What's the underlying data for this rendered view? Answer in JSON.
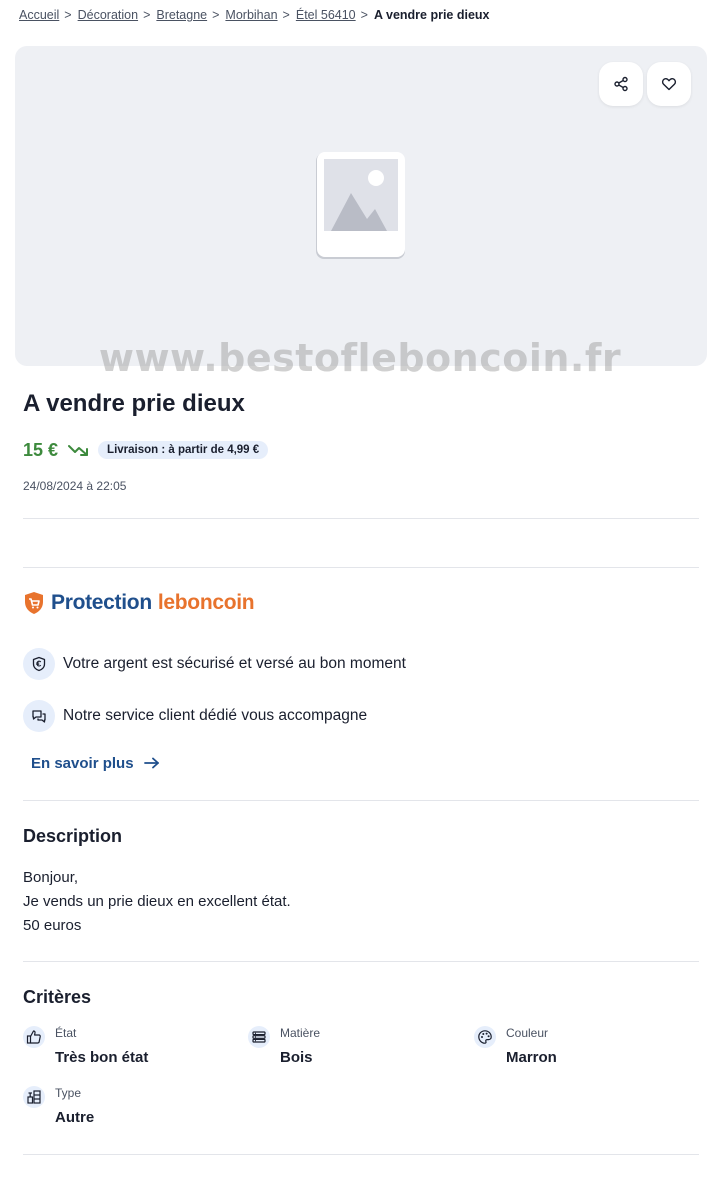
{
  "breadcrumb": {
    "items": [
      "Accueil",
      "Décoration",
      "Bretagne",
      "Morbihan",
      "Étel 56410"
    ],
    "separator": ">",
    "current": "A vendre prie dieux"
  },
  "gallery": {
    "share_icon": "share-icon",
    "favorite_icon": "heart-icon",
    "placeholder_icon": "image-placeholder-icon",
    "watermark": "www.bestofleboncoin.fr"
  },
  "listing": {
    "title": "A vendre prie dieux",
    "price": "15 €",
    "price_trend_icon": "trending-down-icon",
    "delivery": "Livraison : à partir de 4,99 €",
    "date": "24/08/2024 à 22:05"
  },
  "protection": {
    "brand_word": "Protection",
    "brand_name": "leboncoin",
    "features": [
      {
        "icon": "euro-shield-icon",
        "text": "Votre argent est sécurisé et versé au bon moment"
      },
      {
        "icon": "chat-icon",
        "text": "Notre service client dédié vous accompagne"
      }
    ],
    "learn_more": "En savoir plus"
  },
  "description": {
    "title": "Description",
    "lines": [
      "Bonjour,",
      "Je vends un prie dieux en excellent état.",
      "50 euros"
    ]
  },
  "criteria": {
    "title": "Critères",
    "items": [
      {
        "icon": "thumbs-up-icon",
        "label": "État",
        "value": "Très bon état"
      },
      {
        "icon": "layers-icon",
        "label": "Matière",
        "value": "Bois"
      },
      {
        "icon": "palette-icon",
        "label": "Couleur",
        "value": "Marron"
      },
      {
        "icon": "furniture-icon",
        "label": "Type",
        "value": "Autre"
      }
    ]
  },
  "colors": {
    "price": "#3d8a3d",
    "brand_blue": "#1f4f8c",
    "brand_orange": "#e8732d",
    "badge_bg": "#e6eefb"
  }
}
